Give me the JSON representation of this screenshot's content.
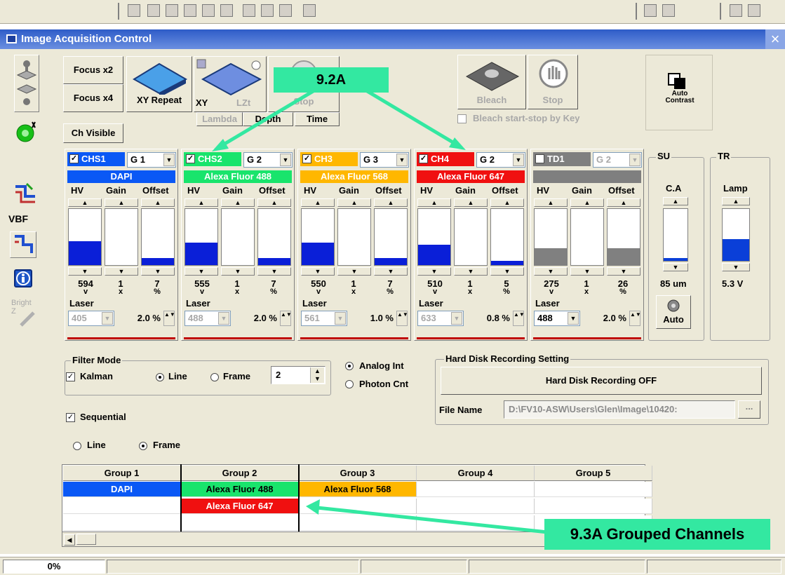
{
  "window": {
    "title": "Image Acquisition Control"
  },
  "scan": {
    "focus_x2": "Focus x2",
    "focus_x4": "Focus x4",
    "xy_repeat": "XY Repeat",
    "xy": "XY",
    "lzt": "LZt",
    "lambda": "Lambda",
    "depth": "Depth",
    "time": "Time",
    "stop_hidden": "Stop",
    "ch_visible": "Ch Visible",
    "vbf": "VBF",
    "bright_z": "Bright Z"
  },
  "bleach": {
    "bleach": "Bleach",
    "stop": "Stop",
    "bleach_by_key": "Bleach start-stop by Key",
    "auto_contrast": "Auto Contrast"
  },
  "col_labels": {
    "hv": "HV",
    "gain": "Gain",
    "offset": "Offset",
    "laser": "Laser",
    "v": "v",
    "x": "x",
    "pct": "%"
  },
  "channels": [
    {
      "name": "CHS1",
      "group": "G 1",
      "dye": "DAPI",
      "color": "#0a58f5",
      "checked": true,
      "hv": "594",
      "gain": "1",
      "offset": "7",
      "laser": "405",
      "laser_pct": "2.0 %",
      "hv_level": 0.42,
      "gain_level": 0,
      "offset_level": 0.12
    },
    {
      "name": "CHS2",
      "group": "G 2",
      "dye": "Alexa Fluor 488",
      "color": "#19e46c",
      "checked": true,
      "hv": "555",
      "gain": "1",
      "offset": "7",
      "laser": "488",
      "laser_pct": "2.0 %",
      "hv_level": 0.4,
      "gain_level": 0,
      "offset_level": 0.12
    },
    {
      "name": "CH3",
      "group": "G 3",
      "dye": "Alexa Fluor 568",
      "color": "#ffb700",
      "checked": true,
      "hv": "550",
      "gain": "1",
      "offset": "7",
      "laser": "561",
      "laser_pct": "1.0 %",
      "hv_level": 0.4,
      "gain_level": 0,
      "offset_level": 0.12
    },
    {
      "name": "CH4",
      "group": "G 2",
      "dye": "Alexa Fluor 647",
      "color": "#f01010",
      "checked": true,
      "hv": "510",
      "gain": "1",
      "offset": "5",
      "laser": "633",
      "laser_pct": "0.8 %",
      "hv_level": 0.36,
      "gain_level": 0,
      "offset_level": 0.08
    },
    {
      "name": "TD1",
      "group": "G 2",
      "dye": "",
      "color": "#7f7f7f",
      "checked": false,
      "hv": "275",
      "gain": "1",
      "offset": "26",
      "laser": "488",
      "laser_pct": "2.0 %",
      "hv_level": 0.3,
      "gain_level": 0,
      "offset_level": 0.3
    }
  ],
  "su": {
    "title": "SU",
    "label": "C.A",
    "value": "85 um",
    "auto": "Auto",
    "level": 0.05
  },
  "tr": {
    "title": "TR",
    "label": "Lamp",
    "value": "5.3 V",
    "level": 0.42
  },
  "filter": {
    "title": "Filter Mode",
    "kalman": "Kalman",
    "line": "Line",
    "frame": "Frame",
    "count": "2",
    "analog": "Analog Int",
    "photon": "Photon Cnt"
  },
  "hdd": {
    "title": "Hard Disk Recording Setting",
    "button": "Hard Disk Recording OFF",
    "file_label": "File Name",
    "file_value": "D:\\FV10-ASW\\Users\\Glen\\Image\\10420:",
    "browse": "..."
  },
  "sequential": {
    "label": "Sequential",
    "line": "Line",
    "frame": "Frame"
  },
  "groups": {
    "headers": [
      "Group 1",
      "Group 2",
      "Group 3",
      "Group 4",
      "Group 5"
    ],
    "row1": [
      "DAPI",
      "Alexa Fluor 488",
      "Alexa Fluor 568",
      "",
      ""
    ],
    "row2": [
      "",
      "Alexa Fluor 647",
      "",
      "",
      ""
    ]
  },
  "callouts": {
    "top": "9.2A",
    "bottom": "9.3A Grouped Channels"
  },
  "status": {
    "progress": "0%"
  },
  "colors": {
    "dapi": "#0a58f5",
    "af488": "#19e46c",
    "af568": "#ffb700",
    "af647": "#f01010",
    "callout": "#33e8a1"
  }
}
